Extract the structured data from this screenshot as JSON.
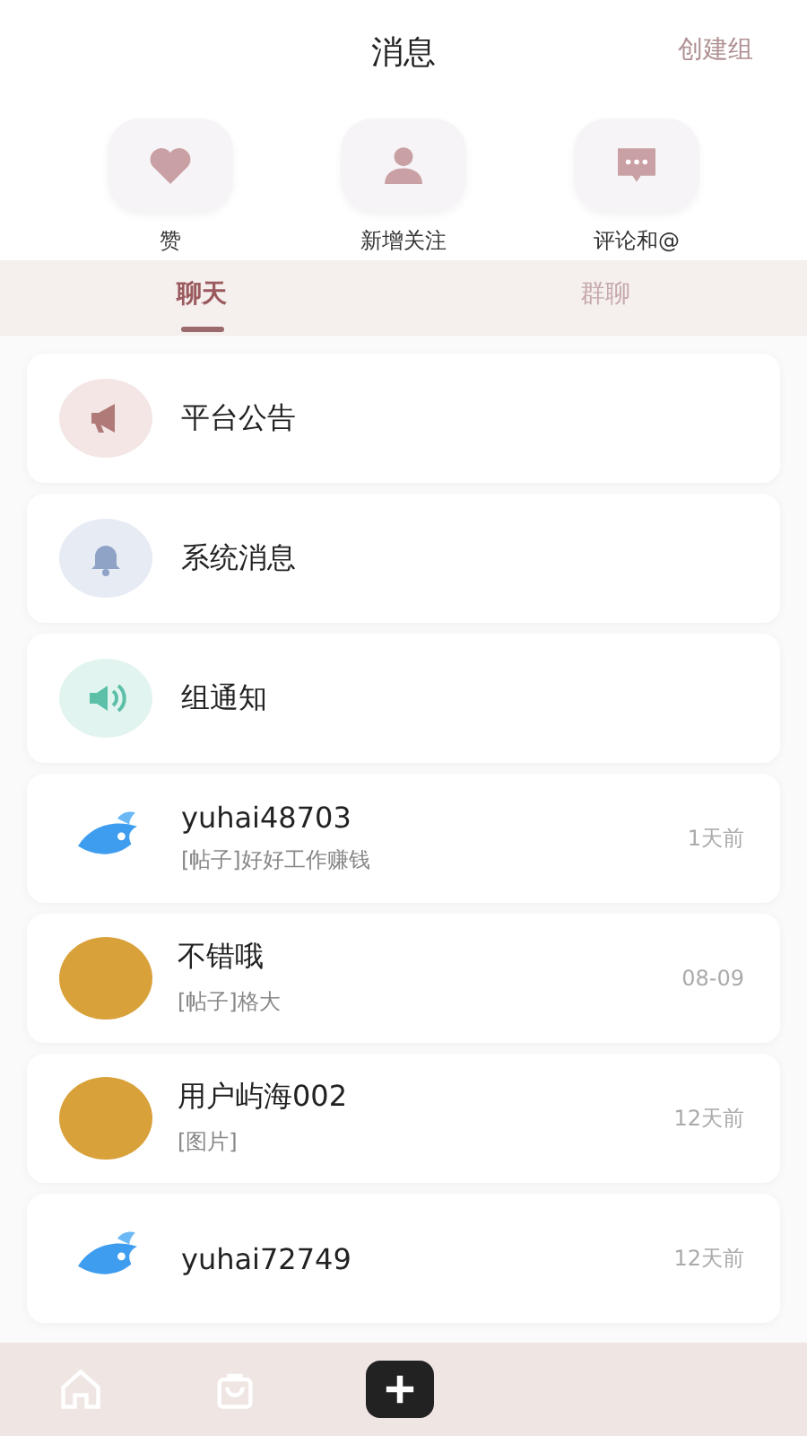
{
  "header": {
    "title": "消息",
    "action": "创建组"
  },
  "shortcuts": [
    {
      "kind": "likes",
      "label": "赞"
    },
    {
      "kind": "follows",
      "label": "新增关注"
    },
    {
      "kind": "comments",
      "label": "评论和@"
    }
  ],
  "tabs": [
    {
      "label": "聊天",
      "selected": true
    },
    {
      "label": "群聊",
      "selected": false
    }
  ],
  "conversations": [
    {
      "kind": "announcement",
      "name": "平台公告"
    },
    {
      "kind": "system",
      "name": "系统消息"
    },
    {
      "kind": "group",
      "name": "组通知"
    },
    {
      "kind": "logo",
      "name": "yuhai48703",
      "preview": "[帖子]好好工作赚钱",
      "time": "1天前"
    },
    {
      "kind": "photo",
      "name": "不错哦",
      "preview": "[帖子]格大",
      "time": "08-09"
    },
    {
      "kind": "photo",
      "name": "用户屿海002",
      "preview": "[图片]",
      "time": "12天前"
    },
    {
      "kind": "logo",
      "name": "yuhai72749",
      "time": "12天前"
    }
  ],
  "nav": [
    {
      "kind": "home"
    },
    {
      "kind": "bag"
    },
    {
      "kind": "plus"
    }
  ]
}
